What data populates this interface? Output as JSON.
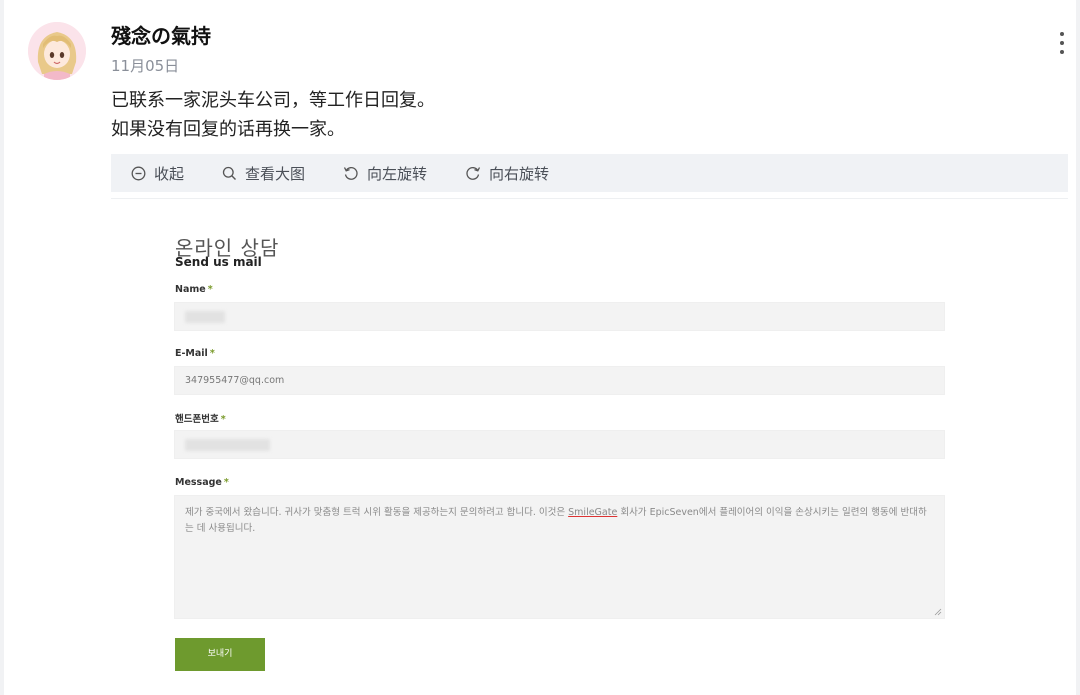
{
  "post": {
    "author": "殘念の氣持",
    "date": "11月05日",
    "lines": [
      "已联系一家泥头车公司，等工作日回复。",
      "如果没有回复的话再换一家。"
    ]
  },
  "toolbar": {
    "items": [
      {
        "label": "收起",
        "icon": "collapse-icon"
      },
      {
        "label": "查看大图",
        "icon": "search-icon"
      },
      {
        "label": "向左旋转",
        "icon": "rotate-left-icon"
      },
      {
        "label": "向右旋转",
        "icon": "rotate-right-icon"
      }
    ]
  },
  "form": {
    "title": "온라인 상담",
    "subtitle": "Send us mail",
    "required_mark": "*",
    "name_label": "Name",
    "email_label": "E-Mail",
    "email_value": "347955477@qq.com",
    "phone_label": "핸드폰번호",
    "message_label": "Message",
    "message_before": "제가 중국에서 왔습니다. 귀사가 맞춤형 트럭 시위 활동을 제공하는지 문의하려고 합니다. 이것은 ",
    "message_link": "SmileGate",
    "message_after": " 회사가 EpicSeven에서 플레이어의 이익을 손상시키는 일련의 행동에 반대하는 데 사용됩니다.",
    "submit_label": "보내기",
    "accent_color": "#6e9a2e"
  }
}
